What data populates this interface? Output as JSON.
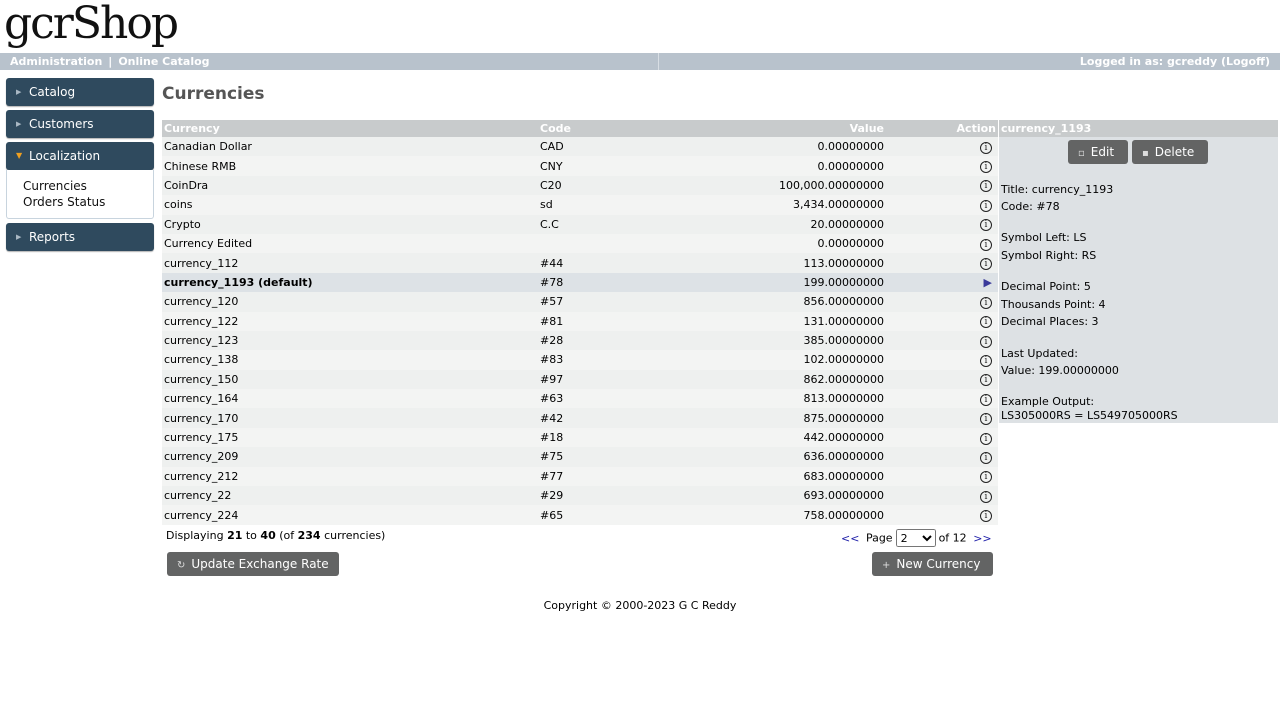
{
  "app": {
    "logo": "gcrShop"
  },
  "header": {
    "admin_link": "Administration",
    "separator": "|",
    "catalog_link": "Online Catalog",
    "logged_in": "Logged in as: gcreddy (Logoff)"
  },
  "sidebar": {
    "catalog": "Catalog",
    "customers": "Customers",
    "localization": "Localization",
    "sub_currencies": "Currencies",
    "sub_orders_status": "Orders Status",
    "reports": "Reports"
  },
  "page_title": "Currencies",
  "table": {
    "headers": {
      "currency": "Currency",
      "code": "Code",
      "value": "Value",
      "action": "Action"
    },
    "rows": [
      {
        "currency": "Canadian Dollar",
        "code": "CAD",
        "value": "0.00000000"
      },
      {
        "currency": "Chinese RMB",
        "code": "CNY",
        "value": "0.00000000"
      },
      {
        "currency": "CoinDra",
        "code": "C20",
        "value": "100,000.00000000"
      },
      {
        "currency": "coins",
        "code": "sd",
        "value": "3,434.00000000"
      },
      {
        "currency": "Crypto",
        "code": "C.C",
        "value": "20.00000000"
      },
      {
        "currency": "Currency Edited",
        "code": "",
        "value": "0.00000000"
      },
      {
        "currency": "currency_112",
        "code": "#44",
        "value": "113.00000000"
      },
      {
        "currency": "currency_1193 (default)",
        "code": "#78",
        "value": "199.00000000"
      },
      {
        "currency": "currency_120",
        "code": "#57",
        "value": "856.00000000"
      },
      {
        "currency": "currency_122",
        "code": "#81",
        "value": "131.00000000"
      },
      {
        "currency": "currency_123",
        "code": "#28",
        "value": "385.00000000"
      },
      {
        "currency": "currency_138",
        "code": "#83",
        "value": "102.00000000"
      },
      {
        "currency": "currency_150",
        "code": "#97",
        "value": "862.00000000"
      },
      {
        "currency": "currency_164",
        "code": "#63",
        "value": "813.00000000"
      },
      {
        "currency": "currency_170",
        "code": "#42",
        "value": "875.00000000"
      },
      {
        "currency": "currency_175",
        "code": "#18",
        "value": "442.00000000"
      },
      {
        "currency": "currency_209",
        "code": "#75",
        "value": "636.00000000"
      },
      {
        "currency": "currency_212",
        "code": "#77",
        "value": "683.00000000"
      },
      {
        "currency": "currency_22",
        "code": "#29",
        "value": "693.00000000"
      },
      {
        "currency": "currency_224",
        "code": "#65",
        "value": "758.00000000"
      }
    ]
  },
  "paging": {
    "displaying_prefix": "Displaying ",
    "from": "21",
    "to_word": " to ",
    "to": "40",
    "of_prefix": " (of ",
    "total": "234",
    "of_suffix": " currencies)",
    "prev": "<<",
    "page_label": "Page",
    "current_page": "2",
    "of_pages": "of 12",
    "next": ">>"
  },
  "buttons": {
    "update_rate": "Update Exchange Rate",
    "new_currency": "New Currency",
    "edit": "Edit",
    "delete": "Delete"
  },
  "info_panel": {
    "title": "currency_1193",
    "title_line": "Title: currency_1193",
    "code_line": "Code: #78",
    "symbol_left": "Symbol Left: LS",
    "symbol_right": "Symbol Right: RS",
    "decimal_point": "Decimal Point: 5",
    "thousands_point": "Thousands Point: 4",
    "decimal_places": "Decimal Places: 3",
    "last_updated": "Last Updated:",
    "value": "Value: 199.00000000",
    "example_label": "Example Output:",
    "example_value": "LS305000RS = LS549705000RS"
  },
  "footer": {
    "copyright": "Copyright © 2000-2023 G C Reddy"
  },
  "icons": {
    "info": "info-circle-icon",
    "selected": "play-arrow-icon",
    "refresh": "refresh-icon",
    "plus": "plus-icon",
    "document": "document-icon",
    "trash": "trash-icon",
    "menu_arrow": "triangle-right-icon"
  },
  "colors": {
    "menu_bg": "#2f4a5e",
    "header_bar": "#b8c2cc",
    "button_bg": "#636464",
    "selected_row": "#dde2e6"
  }
}
